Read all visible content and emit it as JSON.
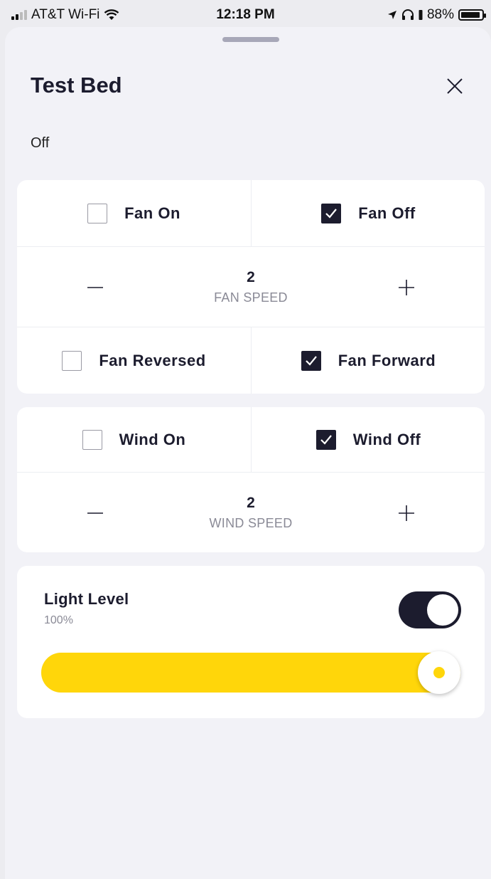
{
  "status_bar": {
    "carrier": "AT&T Wi-Fi",
    "time": "12:18 PM",
    "battery": "88%"
  },
  "sheet": {
    "title": "Test Bed",
    "state": "Off"
  },
  "fan": {
    "on_label": "Fan On",
    "on_checked": false,
    "off_label": "Fan Off",
    "off_checked": true,
    "speed_value": "2",
    "speed_label": "FAN SPEED",
    "reversed_label": "Fan Reversed",
    "reversed_checked": false,
    "forward_label": "Fan Forward",
    "forward_checked": true
  },
  "wind": {
    "on_label": "Wind On",
    "on_checked": false,
    "off_label": "Wind Off",
    "off_checked": true,
    "speed_value": "2",
    "speed_label": "WIND SPEED"
  },
  "light": {
    "title": "Light Level",
    "value_text": "100%",
    "level": 1.0,
    "toggle_on": true
  },
  "colors": {
    "accent_dark": "#1c1c2e",
    "slider_yellow": "#ffd60a"
  }
}
